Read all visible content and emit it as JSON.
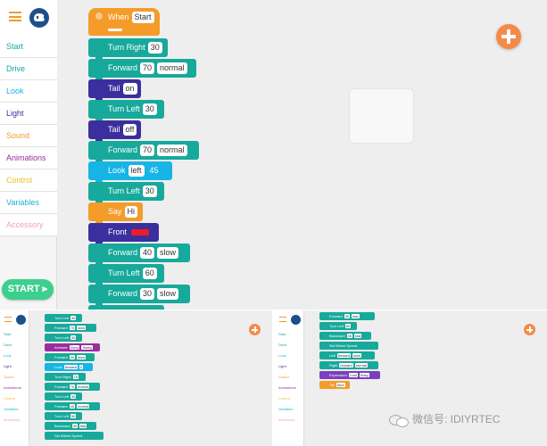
{
  "sidebar": {
    "categories": [
      {
        "label": "Start",
        "color": "#1aa7a0"
      },
      {
        "label": "Drive",
        "color": "#1aa7a0"
      },
      {
        "label": "Look",
        "color": "#16b5e6"
      },
      {
        "label": "Light",
        "color": "#3b2f9e"
      },
      {
        "label": "Sound",
        "color": "#f39c2a"
      },
      {
        "label": "Animations",
        "color": "#9a2ca0"
      },
      {
        "label": "Control",
        "color": "#e6c12a"
      },
      {
        "label": "Variables",
        "color": "#1ab3d8"
      },
      {
        "label": "Accessory",
        "color": "#f5a0b4"
      }
    ],
    "start_button": "START ▸"
  },
  "program": {
    "hat": {
      "label": "When",
      "value": "Start"
    },
    "blocks": [
      {
        "label": "Turn Right",
        "params": [
          "30"
        ]
      },
      {
        "label": "Forward",
        "params": [
          "70",
          "normal"
        ]
      },
      {
        "label": "Tail",
        "params": [
          "on"
        ]
      },
      {
        "label": "Turn Left",
        "params": [
          "30"
        ]
      },
      {
        "label": "Tail",
        "params": [
          "off"
        ]
      },
      {
        "label": "Forward",
        "params": [
          "70",
          "normal"
        ]
      },
      {
        "label": "Look",
        "params": [
          "left",
          "45"
        ]
      },
      {
        "label": "Turn Left",
        "params": [
          "30"
        ]
      },
      {
        "label": "Say",
        "params": [
          "Hi"
        ]
      },
      {
        "label": "Front",
        "params": []
      },
      {
        "label": "Forward",
        "params": [
          "40",
          "slow"
        ]
      },
      {
        "label": "Turn Left",
        "params": [
          "60"
        ]
      },
      {
        "label": "Forward",
        "params": [
          "30",
          "slow"
        ]
      }
    ]
  },
  "thumb1": {
    "blocks": [
      {
        "label": "Turn Left",
        "params": [
          "30"
        ]
      },
      {
        "label": "Forward",
        "params": [
          "70",
          "slow"
        ]
      },
      {
        "label": "Turn Left",
        "params": [
          "30"
        ]
      },
      {
        "label": "Animate",
        "params": [
          "Dizzy",
          "Swirly"
        ]
      },
      {
        "label": "Forward",
        "params": [
          "40",
          "slow"
        ]
      },
      {
        "label": "Look",
        "params": [
          "forward",
          "0"
        ]
      },
      {
        "label": "Turn Right",
        "params": [
          "75"
        ]
      },
      {
        "label": "Forward",
        "params": [
          "70",
          "normal"
        ]
      },
      {
        "label": "Turn Left",
        "params": [
          "30"
        ]
      },
      {
        "label": "Forward",
        "params": [
          "40",
          "normal"
        ]
      },
      {
        "label": "Turn Left",
        "params": [
          "50"
        ]
      },
      {
        "label": "Backward",
        "params": [
          "30",
          "fast"
        ]
      },
      {
        "label": "Set Wheel Speed",
        "params": []
      }
    ]
  },
  "thumb2": {
    "blocks": [
      {
        "label": "Forward",
        "params": [
          "30",
          "fast"
        ]
      },
      {
        "label": "Turn Left",
        "params": [
          "60"
        ]
      },
      {
        "label": "Backward",
        "params": [
          "30",
          "fast"
        ]
      },
      {
        "label": "Set Wheel Speed",
        "params": []
      },
      {
        "label": "Left",
        "params": [
          "forward",
          "slow"
        ]
      },
      {
        "label": "Right",
        "params": [
          "forward",
          "normal"
        ]
      },
      {
        "label": "Expression",
        "params": [
          "Cool",
          "Busy"
        ]
      },
      {
        "label": "Tail",
        "params": [
          "blue"
        ]
      }
    ]
  },
  "watermark": "微信号: IDIYRTEC"
}
